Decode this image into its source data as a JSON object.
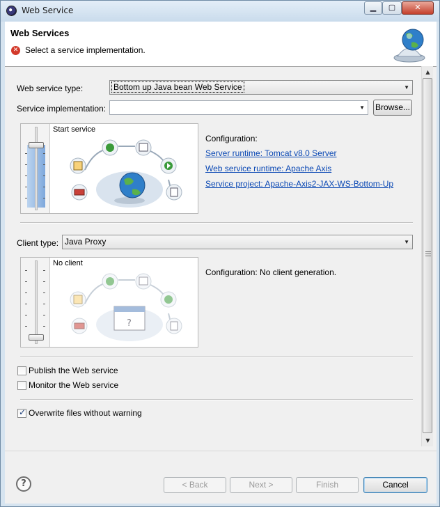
{
  "window": {
    "title": "Web Service"
  },
  "header": {
    "title": "Web Services",
    "message": "Select a service implementation.",
    "message_icon": "error-icon",
    "banner_icon": "web-services-globe-icon"
  },
  "service": {
    "type_label": "Web service type:",
    "type_value": "Bottom up Java bean Web Service",
    "impl_label": "Service implementation:",
    "impl_value": "",
    "browse_label": "Browse...",
    "slider_caption": "Start service",
    "config_label": "Configuration:",
    "links": [
      "Server runtime: Tomcat v8.0 Server",
      "Web service runtime: Apache Axis",
      "Service project: Apache-Axis2-JAX-WS-Bottom-Up"
    ]
  },
  "client": {
    "type_label": "Client type:",
    "type_value": "Java Proxy",
    "slider_caption": "No client",
    "config_text": "Configuration: No client generation."
  },
  "options": {
    "publish": {
      "label": "Publish the Web service",
      "checked": false
    },
    "monitor": {
      "label": "Monitor the Web service",
      "checked": false
    },
    "overwrite": {
      "label": "Overwrite files without warning",
      "checked": true
    }
  },
  "footer": {
    "back": "< Back",
    "next": "Next >",
    "finish": "Finish",
    "cancel": "Cancel"
  },
  "colors": {
    "link": "#0a48b4",
    "error": "#d33a2b",
    "slider_fill": "#7ea8dc"
  }
}
